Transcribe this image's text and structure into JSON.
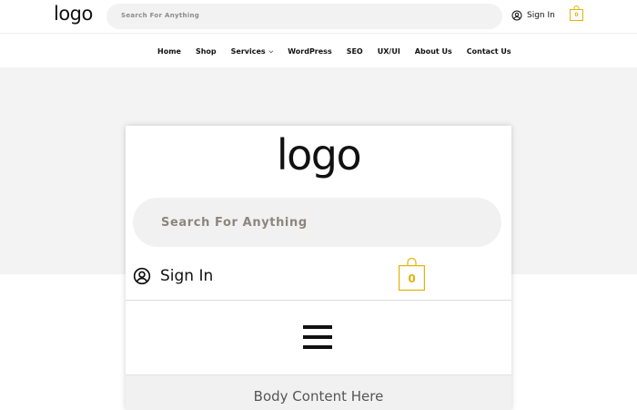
{
  "header": {
    "logo_text": "logo",
    "search_placeholder": "Search For Anything",
    "signin_label": "Sign In",
    "cart_count": "0",
    "cart_color": "#e0b30c"
  },
  "nav": {
    "items": [
      {
        "label": "Home"
      },
      {
        "label": "Shop"
      },
      {
        "label": "Services",
        "has_dropdown": true
      },
      {
        "label": "WordPress"
      },
      {
        "label": "SEO"
      },
      {
        "label": "UX/UI"
      },
      {
        "label": "About Us"
      },
      {
        "label": "Contact Us"
      }
    ]
  },
  "mobile": {
    "logo_text": "logo",
    "search_placeholder": "Search For Anything",
    "signin_label": "Sign In",
    "cart_count": "0",
    "menu_icon": "hamburger-icon",
    "body_text": "Body Content Here"
  },
  "icons": {
    "user": "user-circle-icon",
    "cart": "shopping-bag-icon"
  }
}
